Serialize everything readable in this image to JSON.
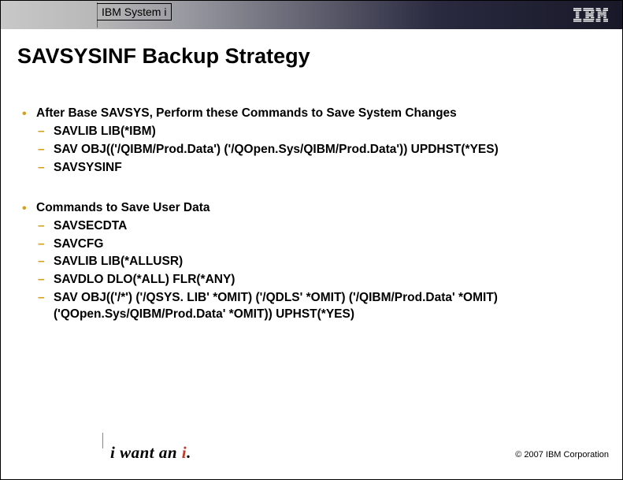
{
  "header": {
    "product_line": "IBM System i",
    "logo_label": "IBM"
  },
  "title": "SAVSYSINF Backup Strategy",
  "sections": [
    {
      "heading": "After Base SAVSYS, Perform these Commands to Save System Changes",
      "items": [
        "SAVLIB LIB(*IBM)",
        "SAV OBJ(('/QIBM/Prod.Data') ('/QOpen.Sys/QIBM/Prod.Data')) UPDHST(*YES)",
        "SAVSYSINF"
      ]
    },
    {
      "heading": "Commands to Save User Data",
      "items": [
        "SAVSECDTA",
        "SAVCFG",
        "SAVLIB LIB(*ALLUSR)",
        "SAVDLO DLO(*ALL) FLR(*ANY)",
        "SAV OBJ(('/*') ('/QSYS. LIB' *OMIT) ('/QDLS' *OMIT) ('/QIBM/Prod.Data' *OMIT) ('QOpen.Sys/QIBM/Prod.Data' *OMIT)) UPHST(*YES)"
      ]
    }
  ],
  "footer": {
    "tagline_prefix": "i want an ",
    "tagline_accent": "i",
    "tagline_suffix": ".",
    "copyright": "© 2007 IBM Corporation"
  }
}
